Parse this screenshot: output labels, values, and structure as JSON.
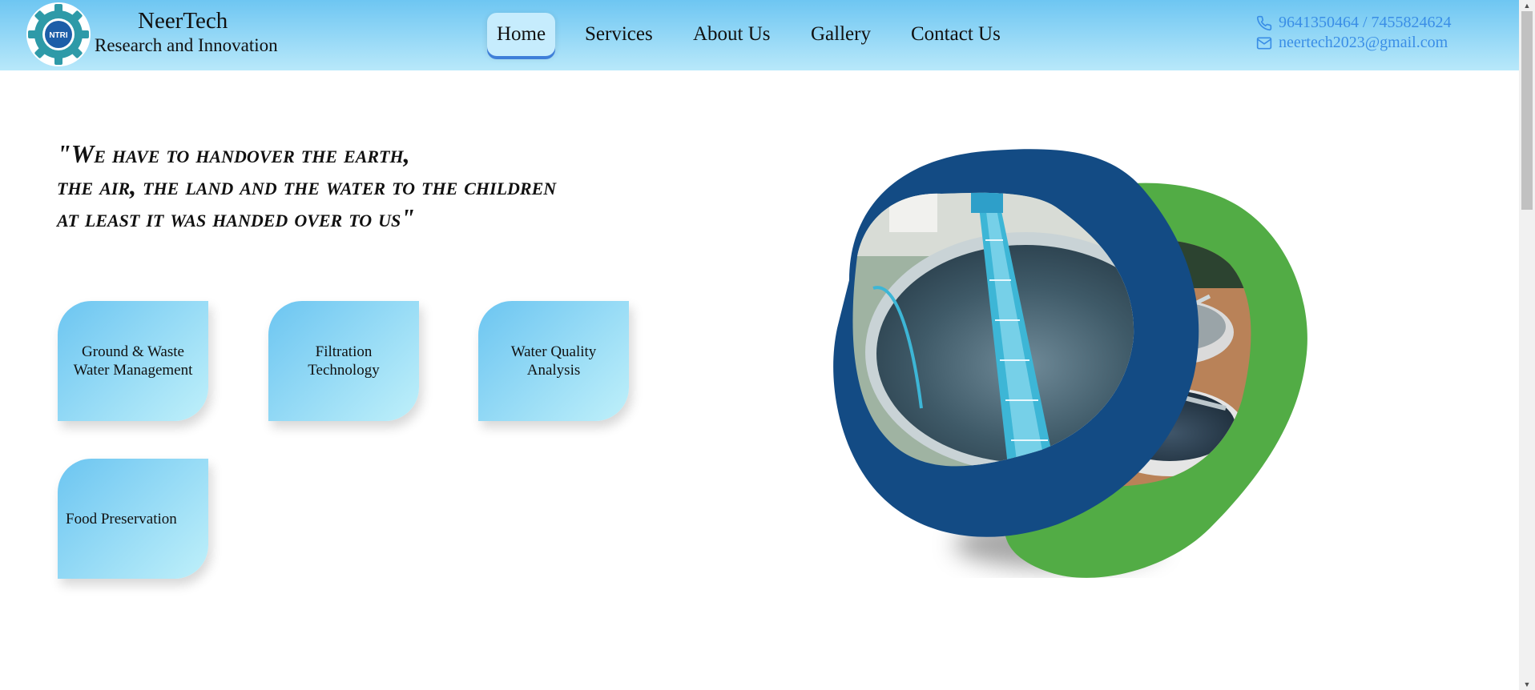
{
  "brand": {
    "logo_text": "NTRI",
    "name": "NeerTech",
    "subtitle": "Research and Innovation"
  },
  "nav": {
    "items": [
      "Home",
      "Services",
      "About Us",
      "Gallery",
      "Contact Us"
    ],
    "active": "Home"
  },
  "contact": {
    "phone": "9641350464 / 7455824624",
    "email": "neertech2023@gmail.com"
  },
  "quote": {
    "line1": "\"We have to handover the earth,",
    "line2": "the air, the land and the water to the children",
    "line3": "at least it was handed over to us\""
  },
  "cards": {
    "ground_waste_line1": "Ground & Waste",
    "ground_waste_line2": "Water Management",
    "filtration_line1": "Filtration",
    "filtration_line2": "Technology",
    "water_quality_line1": "Water Quality",
    "water_quality_line2": "Analysis",
    "food_preservation": "Food Preservation"
  },
  "colors": {
    "header_gradient_top": "#6ec6f2",
    "header_gradient_bottom": "#b8e8fa",
    "nav_active_bg": "#c6ecfd",
    "nav_active_underline": "#3f7fd9",
    "contact_text": "#3a8ee6",
    "blob_blue": "#134b84",
    "blob_green": "#52ac45"
  },
  "icons": {
    "phone": "phone-icon",
    "email": "envelope-icon"
  }
}
